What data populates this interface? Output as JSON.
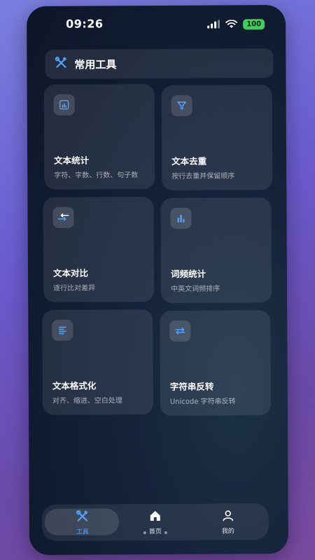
{
  "status_bar": {
    "time": "09:26",
    "battery": "100",
    "icons": [
      "signal-icon",
      "wifi-icon",
      "battery-icon"
    ]
  },
  "header": {
    "icon": "tools-icon",
    "title": "常用工具"
  },
  "tools": [
    {
      "title": "文本统计",
      "desc": "字符、字数、行数、句子数",
      "icon": "stats-chart-icon"
    },
    {
      "title": "文本去重",
      "desc": "按行去重并保留顺序",
      "icon": "filter-icon"
    },
    {
      "title": "文本对比",
      "desc": "逐行比对差异",
      "icon": "compare-arrows-icon"
    },
    {
      "title": "词频统计",
      "desc": "中英文词频排序",
      "icon": "bar-chart-icon"
    },
    {
      "title": "文本格式化",
      "desc": "对齐、缩进、空白处理",
      "icon": "align-left-icon"
    },
    {
      "title": "字符串反转",
      "desc": "Unicode 字符串反转",
      "icon": "swap-arrows-icon"
    }
  ],
  "tab_bar": {
    "tabs": [
      {
        "label": "工具",
        "icon": "tools-icon",
        "active": true
      },
      {
        "label": "首页",
        "icon": "home-icon",
        "active": false
      },
      {
        "label": "我的",
        "icon": "user-icon",
        "active": false
      }
    ]
  },
  "colors": {
    "accent": "#4ea3ff",
    "battery": "#3ecf5a",
    "background_gradient": [
      "#7a7fe0",
      "#6a4aa8"
    ],
    "phone_bg": "#101a2e"
  }
}
